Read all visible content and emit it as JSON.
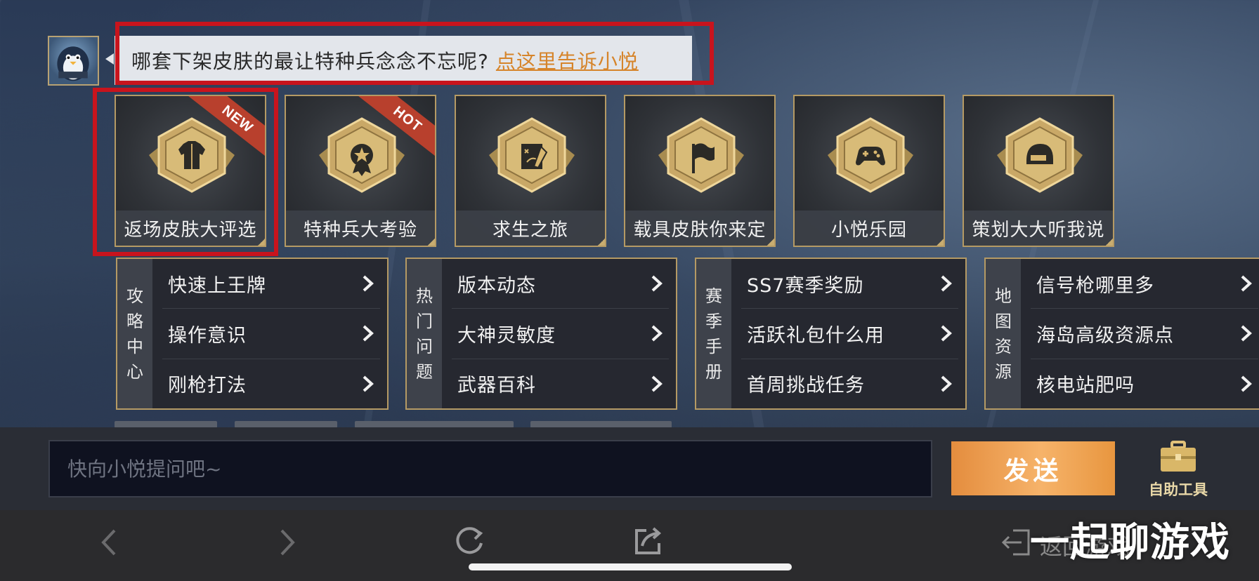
{
  "header": {
    "question": "哪套下架皮肤的最让特种兵念念不忘呢?",
    "link": "点这里告诉小悦"
  },
  "tiles": [
    {
      "label": "返场皮肤大评选",
      "badge": "NEW",
      "icon": "jacket-icon"
    },
    {
      "label": "特种兵大考验",
      "badge": "HOT",
      "icon": "star-medal-icon"
    },
    {
      "label": "求生之旅",
      "badge": "",
      "icon": "map-pencil-icon"
    },
    {
      "label": "载具皮肤你来定",
      "badge": "",
      "icon": "flag-icon"
    },
    {
      "label": "小悦乐园",
      "badge": "",
      "icon": "gamepad-icon"
    },
    {
      "label": "策划大大听我说",
      "badge": "",
      "icon": "helmet-icon"
    }
  ],
  "panels": [
    {
      "side": [
        "攻",
        "略",
        "中",
        "心"
      ],
      "items": [
        "快速上王牌",
        "操作意识",
        "刚枪打法"
      ]
    },
    {
      "side": [
        "热",
        "门",
        "问",
        "题"
      ],
      "items": [
        "版本动态",
        "大神灵敏度",
        "武器百科"
      ]
    },
    {
      "side": [
        "赛",
        "季",
        "手",
        "册"
      ],
      "items": [
        "SS7赛季奖励",
        "活跃礼包什么用",
        "首周挑战任务"
      ]
    },
    {
      "side": [
        "地",
        "图",
        "资",
        "源"
      ],
      "items": [
        "信号枪哪里多",
        "海岛高级资源点",
        "核电站肥吗"
      ]
    }
  ],
  "input": {
    "placeholder": "快向小悦提问吧~"
  },
  "send_label": "发送",
  "tools_label": "自助工具",
  "nav": {
    "back_label": "返回游戏"
  },
  "watermark": "一起聊游戏",
  "colors": {
    "accent_gold": "#b59a64",
    "send_orange": "#f0a553",
    "link_orange": "#d6842a",
    "highlight_red": "#c8141d"
  }
}
